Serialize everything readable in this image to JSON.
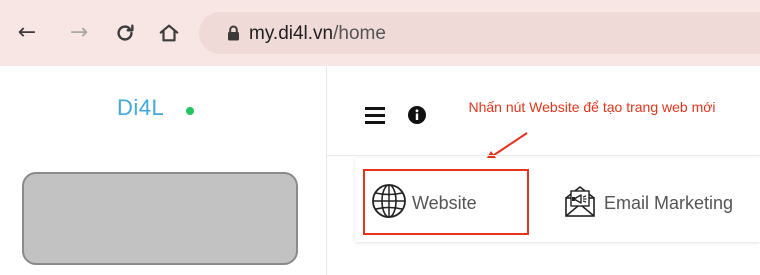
{
  "browser": {
    "url_domain": "my.di4l.vn",
    "url_path": "/home",
    "icons": [
      "back-arrow-icon",
      "forward-arrow-icon",
      "reload-icon",
      "home-icon",
      "lock-icon"
    ]
  },
  "sidebar": {
    "brand": "Di4L",
    "brand_color": "#3fa9e0",
    "status_dot_color": "#22c55e"
  },
  "main": {
    "annotation": "Nhấn nút Website để tạo trang web mới",
    "annotation_color": "#e8331a",
    "tabs": [
      {
        "label": "Website",
        "icon": "globe-icon"
      },
      {
        "label": "Email Marketing",
        "icon": "email-megaphone-icon"
      }
    ]
  }
}
